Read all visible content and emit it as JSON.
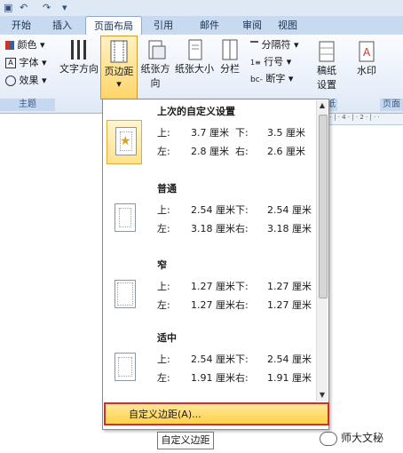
{
  "quick_access": {
    "undo": "↶",
    "redo": "↷",
    "customize": "▾"
  },
  "ribbon_tabs": [
    "开始",
    "插入",
    "页面布局",
    "引用",
    "邮件",
    "审阅",
    "视图"
  ],
  "theme_group": {
    "colors": "颜色 ▾",
    "fonts": "字体 ▾",
    "effects": "效果 ▾",
    "group_label": "主题"
  },
  "page_setup": {
    "text_direction": "文字方向",
    "margins": "页边距",
    "margins_arrow": "▾",
    "orientation": "纸张方向",
    "size": "纸张大小",
    "columns": "分栏",
    "breaks": "分隔符 ▾",
    "line_numbers": "行号 ▾",
    "hyphenation": "断字 ▾"
  },
  "manuscript": {
    "line1": "稿纸",
    "line2": "设置",
    "group_label": "纸"
  },
  "watermark_btn": "水印",
  "page_bg_label": "页面",
  "ruler_text": "8 · | · 4 · | · 2 · | · ·",
  "margin_presets": [
    {
      "name": "上次的自定义设置",
      "top_label": "上:",
      "top_value": "3.7 厘米",
      "bottom_label": "下:",
      "bottom_value": "3.5 厘米",
      "left_label": "左:",
      "left_value": "2.8 厘米",
      "right_label": "右:",
      "right_value": "2.6 厘米"
    },
    {
      "name": "普通",
      "top_label": "上:",
      "top_value": "2.54 厘米",
      "bottom_label": "下:",
      "bottom_value": "2.54 厘米",
      "left_label": "左:",
      "left_value": "3.18 厘米",
      "right_label": "右:",
      "right_value": "3.18 厘米"
    },
    {
      "name": "窄",
      "top_label": "上:",
      "top_value": "1.27 厘米",
      "bottom_label": "下:",
      "bottom_value": "1.27 厘米",
      "left_label": "左:",
      "left_value": "1.27 厘米",
      "right_label": "右:",
      "right_value": "1.27 厘米"
    },
    {
      "name": "适中",
      "top_label": "上:",
      "top_value": "2.54 厘米",
      "bottom_label": "下:",
      "bottom_value": "2.54 厘米",
      "left_label": "左:",
      "left_value": "1.91 厘米",
      "right_label": "右:",
      "right_value": "1.91 厘米"
    }
  ],
  "custom_margins": "自定义边距(A)...",
  "tooltip": "自定义边距",
  "watermark_text": "师大文秘",
  "colors": {
    "accent_red": "#d42b2b",
    "highlight": "#ffd24a"
  }
}
